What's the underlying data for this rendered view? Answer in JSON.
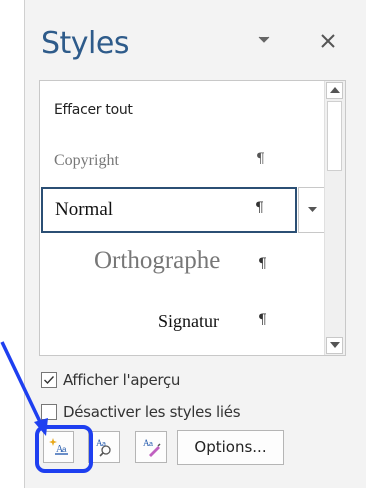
{
  "pane": {
    "title": "Styles"
  },
  "styles_list": {
    "items": [
      {
        "label": "Effacer tout",
        "mark": ""
      },
      {
        "label": "Copyright",
        "mark": "¶"
      },
      {
        "label": "Normal",
        "mark": "¶"
      },
      {
        "label": "Orthographe",
        "mark": "¶"
      },
      {
        "label": "Signatur",
        "mark": "¶"
      }
    ],
    "selected": "Normal"
  },
  "options": {
    "show_preview": {
      "label": "Afficher l'aperçu",
      "checked": true
    },
    "disable_linked": {
      "label": "Désactiver les styles liés",
      "checked": false
    }
  },
  "toolbar": {
    "options_label": "Options..."
  },
  "colors": {
    "title": "#2e5b8a",
    "selection_border": "#2b4f74",
    "highlight": "#1e3ff0"
  }
}
